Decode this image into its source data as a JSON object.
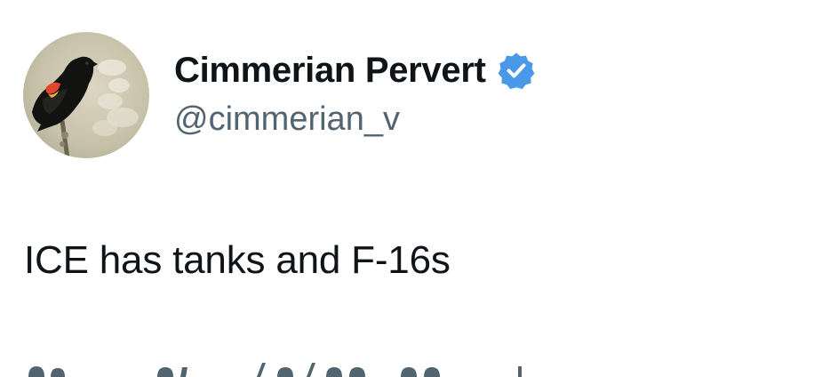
{
  "author": {
    "display_name": "Cimmerian Pervert",
    "handle": "@cimmerian_v",
    "verified": true,
    "verified_color": "#4a99e9",
    "avatar_icon": "red-winged-blackbird-avatar"
  },
  "tweet": {
    "text": "ICE has tanks and F-16s"
  },
  "colors": {
    "text_primary": "#0f1419",
    "text_secondary": "#536471",
    "background": "#ffffff"
  }
}
